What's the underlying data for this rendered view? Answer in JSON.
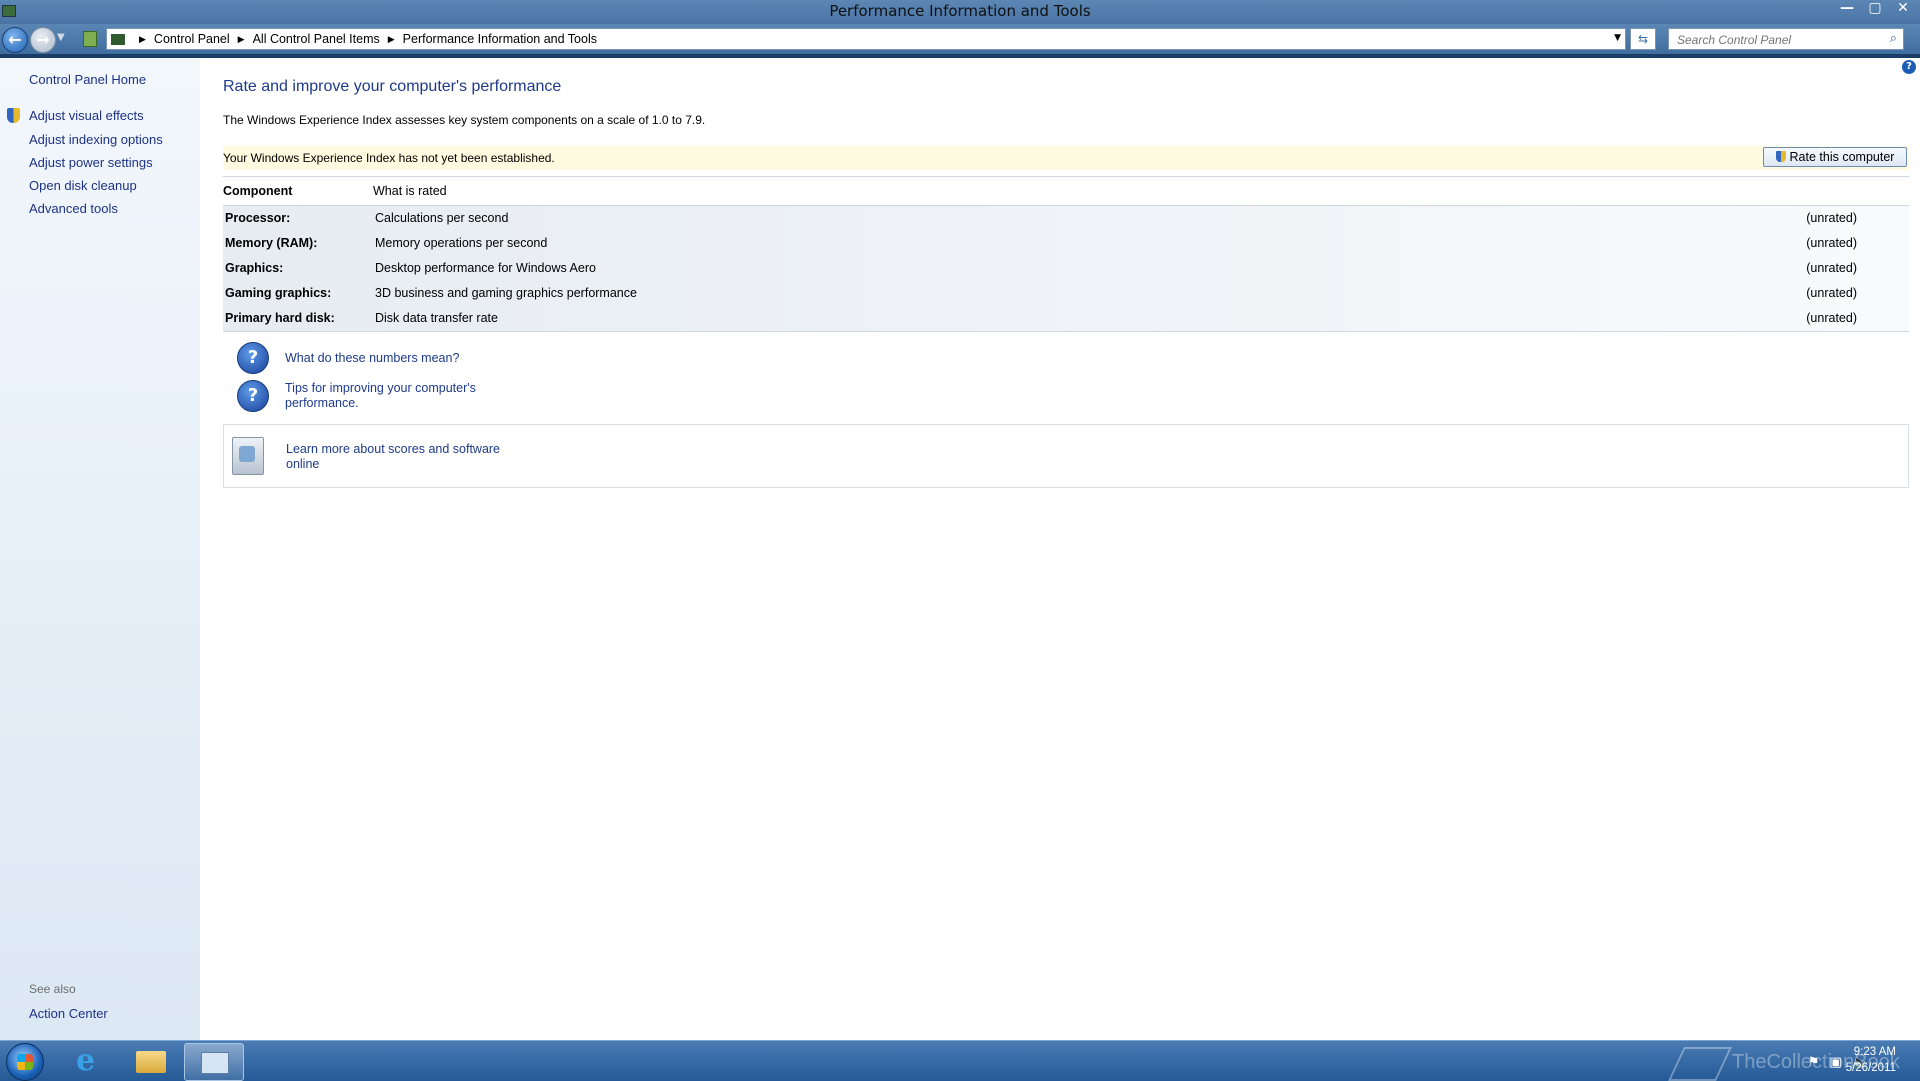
{
  "window": {
    "title": "Performance Information and Tools",
    "controls": {
      "minimize": "—",
      "maximize": "▢",
      "close": "✕"
    }
  },
  "address_bar": {
    "breadcrumbs": [
      "Control Panel",
      "All Control Panel Items",
      "Performance Information and Tools"
    ],
    "search_placeholder": "Search Control Panel"
  },
  "sidebar": {
    "home": "Control Panel Home",
    "items": [
      {
        "label": "Adjust visual effects",
        "icon": "uac-shield-icon"
      },
      {
        "label": "Adjust indexing options"
      },
      {
        "label": "Adjust power settings"
      },
      {
        "label": "Open disk cleanup"
      },
      {
        "label": "Advanced tools"
      }
    ],
    "see_also_label": "See also",
    "see_also_items": [
      "Action Center"
    ]
  },
  "main": {
    "heading": "Rate and improve your computer's performance",
    "intro": "The Windows Experience Index assesses key system components on a scale of 1.0 to 7.9.",
    "status_message": "Your Windows Experience Index has not yet been established.",
    "rate_button": "Rate this computer",
    "table": {
      "headers": [
        "Component",
        "What is rated"
      ],
      "rows": [
        {
          "component": "Processor:",
          "description": "Calculations per second",
          "score": "(unrated)"
        },
        {
          "component": "Memory (RAM):",
          "description": "Memory operations per second",
          "score": "(unrated)"
        },
        {
          "component": "Graphics:",
          "description": "Desktop performance for Windows Aero",
          "score": "(unrated)"
        },
        {
          "component": "Gaming graphics:",
          "description": "3D business and gaming graphics performance",
          "score": "(unrated)"
        },
        {
          "component": "Primary hard disk:",
          "description": "Disk data transfer rate",
          "score": "(unrated)"
        }
      ]
    },
    "help_links": [
      {
        "line1": "What do these numbers mean?",
        "line2": ""
      },
      {
        "line1": "Tips for improving your computer's",
        "line2": "performance."
      }
    ],
    "learn_more": {
      "line1": "Learn more about scores and software",
      "line2": "online"
    }
  },
  "taskbar": {
    "time": "9:23 AM",
    "date": "5/26/2011",
    "watermark": "TheCollectionBook"
  },
  "colors": {
    "link": "#1e3a8a",
    "sidebar_link": "#1e3287",
    "status_bg": "#fffbe1",
    "taskbar": "#245a97"
  }
}
